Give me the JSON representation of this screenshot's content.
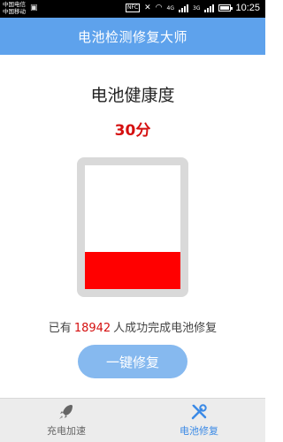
{
  "status_bar": {
    "carrier_1": "中国电信",
    "carrier_2": "中国移动",
    "nfc": "NFC",
    "network_1": "4G",
    "network_2": "3G",
    "time": "10:25"
  },
  "app_bar": {
    "title": "电池检测修复大师"
  },
  "main": {
    "heading": "电池健康度",
    "score": "30分",
    "battery_level": 0.3,
    "stats_prefix": "已有",
    "stats_count": "18942",
    "stats_suffix": "人成功完成电池修复",
    "repair_button": "一键修复"
  },
  "bottom_nav": {
    "tabs": [
      {
        "label": "充电加速",
        "icon": "rocket-icon",
        "active": false
      },
      {
        "label": "电池修复",
        "icon": "wrench-screwdriver-icon",
        "active": true
      }
    ]
  },
  "colors": {
    "app_bar": "#5ea2ec",
    "score": "#d51010",
    "battery_fill": "#ff0000",
    "button": "#86b9ef",
    "active_tab": "#3b8ae6"
  }
}
